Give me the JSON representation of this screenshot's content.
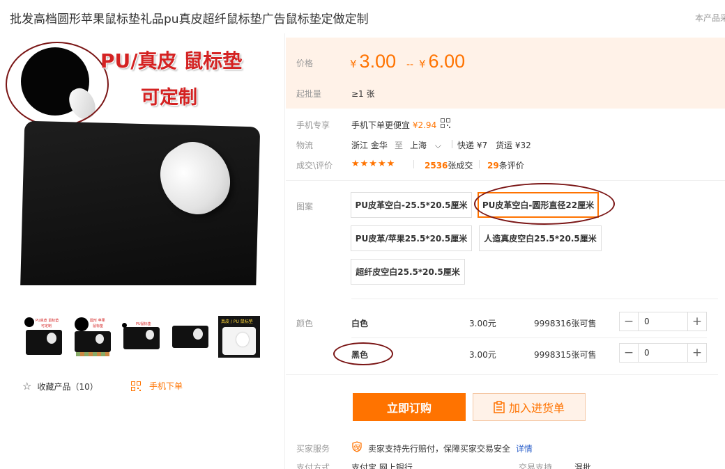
{
  "product": {
    "title": "批发高档圆形苹果鼠标垫礼品pu真皮超纤鼠标垫广告鼠标垫定做定制",
    "title_right": "本产品采"
  },
  "main_image": {
    "headline": "PU/真皮 鼠标垫",
    "subline": "可定制"
  },
  "thumbnails": [
    {
      "caption": "PU真皮 鼠标垫 可定制"
    },
    {
      "caption": "圆形 苹果 鼠标垫"
    },
    {
      "caption": "PU鼠标垫"
    },
    {
      "caption": ""
    },
    {
      "caption": "真皮 / PU 鼠标垫"
    }
  ],
  "left_actions": {
    "favorite_label": "收藏产品（10）",
    "mobile_order_label": "手机下单"
  },
  "price": {
    "label": "价格",
    "currency": "¥",
    "low": "3.00",
    "separator": "--",
    "high": "6.00",
    "moq_label": "起批量",
    "moq_value": "≥1 张"
  },
  "mobile": {
    "label": "手机专享",
    "text": "手机下单更便宜",
    "price": "¥2.94"
  },
  "logistics": {
    "label": "物流",
    "from": "浙江 金华",
    "to_word": "至",
    "to": "上海",
    "express": "快递 ¥7",
    "freight": "货运 ¥32"
  },
  "reviews": {
    "label": "成交\\评价",
    "stars": "★★★★★",
    "rating": 5,
    "deal_count": "2536",
    "deal_suffix": "张成交",
    "review_count": "29",
    "review_suffix": "条评价"
  },
  "pattern": {
    "label": "图案",
    "options": [
      {
        "label": "PU皮革空白-25.5*20.5厘米",
        "selected": false
      },
      {
        "label": "PU皮革空白-圆形直径22厘米",
        "selected": true
      },
      {
        "label": "PU皮革/苹果25.5*20.5厘米",
        "selected": false
      },
      {
        "label": "人造真皮空白25.5*20.5厘米",
        "selected": false
      },
      {
        "label": "超纤皮空白25.5*20.5厘米",
        "selected": false
      }
    ]
  },
  "colors": {
    "label": "颜色",
    "rows": [
      {
        "name": "白色",
        "price": "3.00元",
        "stock": "9998316张可售",
        "qty": "0"
      },
      {
        "name": "黑色",
        "price": "3.00元",
        "stock": "9998315张可售",
        "qty": "0"
      }
    ]
  },
  "actions": {
    "buy_now": "立即订购",
    "add_to_cart": "加入进货单"
  },
  "service": {
    "label": "买家服务",
    "text": "卖家支持先行赔付，保障买家交易安全",
    "link": "详情",
    "badge": "保"
  },
  "payment": {
    "label": "支付方式",
    "methods": "支付宝  网上银行",
    "trade_label": "交易支持",
    "trade_value": "混批"
  },
  "theme": {
    "accent": "#ff7300",
    "price_band": "#fff2e8",
    "annotation": "#7a1515",
    "link": "#3366cc"
  }
}
